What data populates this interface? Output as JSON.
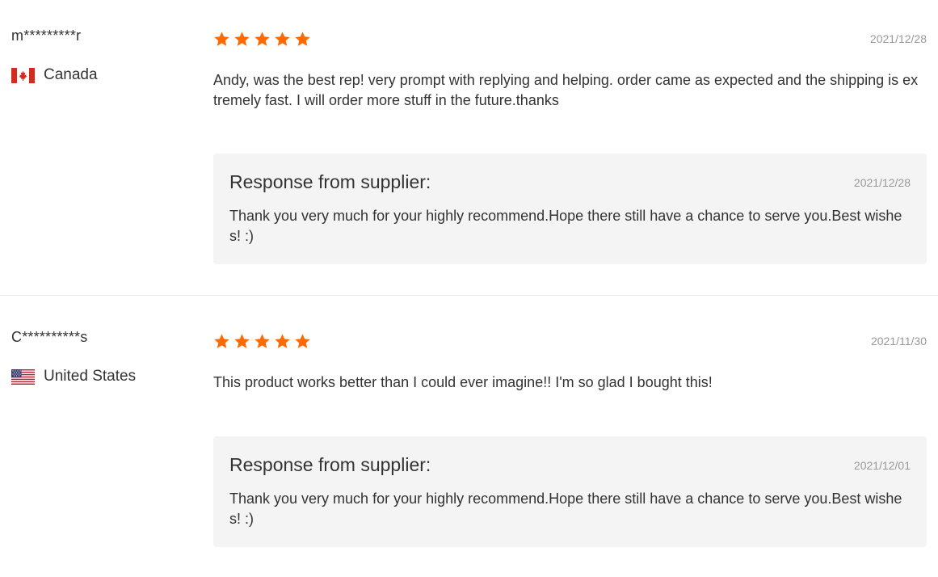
{
  "colors": {
    "star": "#ff6a00",
    "response_bg": "#f4f4f4",
    "date": "#999999",
    "text": "#333333"
  },
  "reviews": [
    {
      "username": "m*********r",
      "country": "Canada",
      "flag_icon": "canada-flag-icon",
      "rating": 5,
      "date": "2021/12/28",
      "text": "Andy, was the best rep! very prompt with replying and helping. order came as expected and the shipping is extremely fast. I will order more stuff in the future.thanks",
      "response": {
        "title": "Response from supplier:",
        "date": "2021/12/28",
        "text": "Thank you very much for your highly recommend.Hope there still have a chance to serve you.Best wishes! :)"
      }
    },
    {
      "username": "C**********s",
      "country": "United States",
      "flag_icon": "usa-flag-icon",
      "rating": 5,
      "date": "2021/11/30",
      "text": "This product works better than I could ever imagine!! I'm so glad I bought this!",
      "response": {
        "title": "Response from supplier:",
        "date": "2021/12/01",
        "text": "Thank you very much for your highly recommend.Hope there still have a chance to serve you.Best wishes! :)"
      }
    }
  ]
}
